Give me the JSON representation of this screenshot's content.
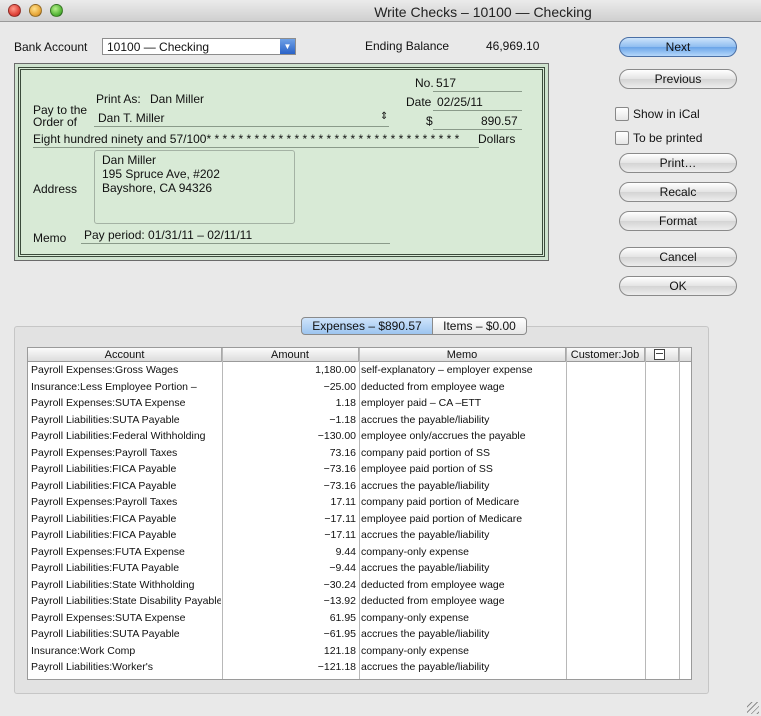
{
  "window": {
    "title": "Write Checks – 10100 — Checking"
  },
  "header": {
    "bank_account_label": "Bank Account",
    "bank_account_value": "10100 — Checking",
    "ending_balance_label": "Ending Balance",
    "ending_balance_value": "46,969.10"
  },
  "check": {
    "no_label": "No.",
    "no_value": "517",
    "date_label": "Date",
    "date_value": "02/25/11",
    "dollar_sign": "$",
    "amount": "890.57",
    "pay_to_label_1": "Pay to the",
    "pay_to_label_2": "Order of",
    "print_as_label": "Print As:",
    "print_as_value": "Dan Miller",
    "payee": "Dan T. Miller",
    "written_amount": "Eight hundred ninety and 57/100* * * * * * * * * * * * * * * * * * * * * * * * * * * * * * * *",
    "dollars_label": "Dollars",
    "address_label": "Address",
    "address_lines": [
      "Dan Miller",
      "195 Spruce Ave, #202",
      "Bayshore, CA 94326"
    ],
    "memo_label": "Memo",
    "memo_value": "Pay period: 01/31/11 – 02/11/11"
  },
  "buttons": {
    "next": "Next",
    "previous": "Previous",
    "print": "Print…",
    "recalc": "Recalc",
    "format": "Format",
    "cancel": "Cancel",
    "ok": "OK"
  },
  "options": {
    "show_in_ical": "Show in iCal",
    "to_be_printed": "To be printed"
  },
  "tabs": {
    "expenses": "Expenses – $890.57",
    "items": "Items – $0.00"
  },
  "table": {
    "columns": [
      "Account",
      "Amount",
      "Memo",
      "Customer:Job"
    ],
    "rows": [
      [
        "Payroll Expenses:Gross Wages",
        "1,180.00",
        "self-explanatory – employer expense"
      ],
      [
        "Insurance:Less Employee Portion –",
        "−25.00",
        "deducted from employee wage"
      ],
      [
        "Payroll Expenses:SUTA Expense",
        "1.18",
        "employer paid – CA –ETT"
      ],
      [
        "Payroll Liabilities:SUTA Payable",
        "−1.18",
        "accrues the payable/liability"
      ],
      [
        "Payroll Liabilities:Federal Withholding",
        "−130.00",
        "employee only/accrues the payable"
      ],
      [
        "Payroll Expenses:Payroll Taxes",
        "73.16",
        "company paid portion of SS"
      ],
      [
        "Payroll Liabilities:FICA Payable",
        "−73.16",
        "employee paid portion of SS"
      ],
      [
        "Payroll Liabilities:FICA Payable",
        "−73.16",
        "accrues the payable/liability"
      ],
      [
        "Payroll Expenses:Payroll Taxes",
        "17.11",
        "company paid portion of Medicare"
      ],
      [
        "Payroll Liabilities:FICA Payable",
        "−17.11",
        "employee paid portion of Medicare"
      ],
      [
        "Payroll Liabilities:FICA Payable",
        "−17.11",
        "accrues the payable/liability"
      ],
      [
        "Payroll Expenses:FUTA Expense",
        "9.44",
        "company-only expense"
      ],
      [
        "Payroll Liabilities:FUTA Payable",
        "−9.44",
        "accrues the payable/liability"
      ],
      [
        "Payroll Liabilities:State Withholding",
        "−30.24",
        "deducted from employee wage"
      ],
      [
        "Payroll Liabilities:State Disability Payable",
        "−13.92",
        "deducted from employee wage"
      ],
      [
        "Payroll Expenses:SUTA Expense",
        "61.95",
        "company-only expense"
      ],
      [
        "Payroll Liabilities:SUTA Payable",
        "−61.95",
        "accrues the payable/liability"
      ],
      [
        "Insurance:Work Comp",
        "121.18",
        "company-only expense"
      ],
      [
        "Payroll Liabilities:Worker's",
        "−121.18",
        "accrues the payable/liability"
      ]
    ]
  }
}
